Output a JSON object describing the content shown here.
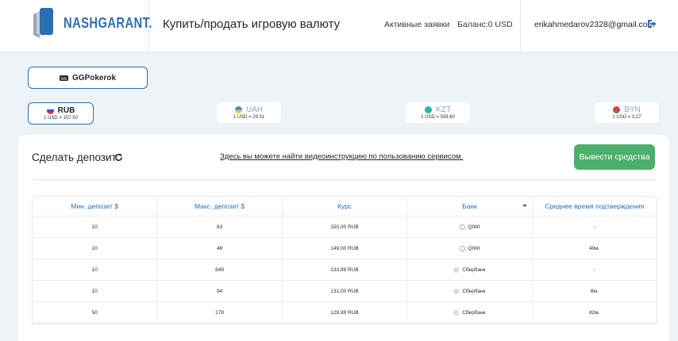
{
  "header": {
    "logo_text": "NASHGARANT.",
    "title": "Купить/продать игровую валюту",
    "active_orders": "Активные заявки",
    "balance": "Баланс:0 USD",
    "email": "erikahmedarov2328@gmail.com",
    "logout_icon": "logout-icon"
  },
  "platform": {
    "label": "GGPokerok",
    "icon": "ggpoker-icon"
  },
  "currencies": [
    {
      "code": "RUB",
      "rate": "1 USD = 107.50",
      "active": true,
      "color": "#d63a3a"
    },
    {
      "code": "UAH",
      "rate": "1 USD = 29.51",
      "active": false,
      "color": "#f2c230"
    },
    {
      "code": "KZT",
      "rate": "1 USD = 508.60",
      "active": false,
      "color": "#2bb5a5"
    },
    {
      "code": "BYN",
      "rate": "1 USD = 3.27",
      "active": false,
      "color": "#d04545"
    }
  ],
  "panel": {
    "title": "Сделать депозит",
    "video_link": "Здесь вы можете найти видеоинструкцию по пользованию сервисом.",
    "withdraw_button": "Вывести средства"
  },
  "table": {
    "headers": [
      "Мин. депозит $",
      "Макс. депозит $",
      "Курс",
      "Банк",
      "Среднее время подтверждения"
    ],
    "rows": [
      {
        "min": "10",
        "max": "83",
        "rate": "150,00 RUB",
        "bank": "QIWI",
        "bank_type": "qiwi",
        "time": "-"
      },
      {
        "min": "10",
        "max": "48",
        "rate": "149,00 RUB",
        "bank": "QIWI",
        "bank_type": "qiwi",
        "time": "49м."
      },
      {
        "min": "10",
        "max": "849",
        "rate": "133,99 RUB",
        "bank": "Сбербанк",
        "bank_type": "sber",
        "time": "-"
      },
      {
        "min": "10",
        "max": "94",
        "rate": "131,00 RUB",
        "bank": "Сбербанк",
        "bank_type": "sber",
        "time": "8м."
      },
      {
        "min": "50",
        "max": "178",
        "rate": "129,99 RUB",
        "bank": "Сбербанк",
        "bank_type": "sber",
        "time": "82м."
      }
    ]
  },
  "colors": {
    "accent": "#2a6fb0",
    "success": "#4caf6b",
    "background": "#eef3f8"
  }
}
